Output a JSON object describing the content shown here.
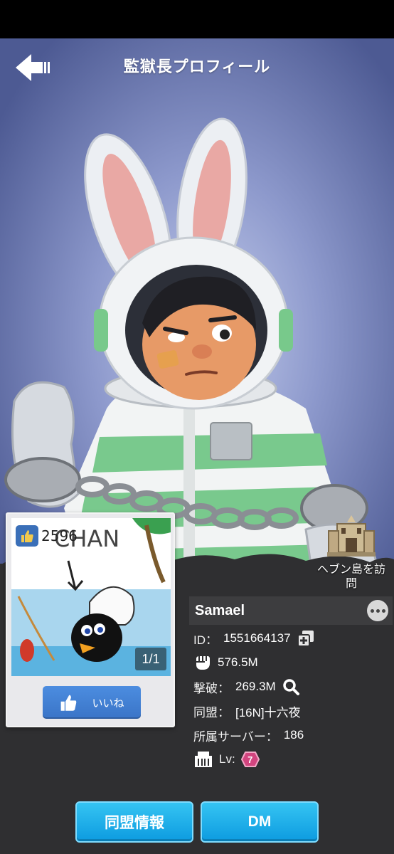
{
  "header": {
    "title": "監獄長プロフィール",
    "back_icon": "arrow-left-icon"
  },
  "photo_card": {
    "like_count": "2596",
    "pager": "1/1",
    "like_button_label": "いいね",
    "photo_caption": "CHAN"
  },
  "visit_island": {
    "label": "ヘブン島を訪問"
  },
  "profile": {
    "name": "Samael",
    "id_label": "ID：",
    "id_value": "1551664137",
    "power_value": "576.5M",
    "kills_label": "撃破：",
    "kills_value": "269.3M",
    "alliance_label": "同盟：",
    "alliance_value": "[16N]十六夜",
    "server_label": "所属サーバー：",
    "server_value": "186",
    "level_label": "Lv:",
    "level_value": "7"
  },
  "buttons": {
    "alliance_info": "同盟情報",
    "dm": "DM"
  },
  "colors": {
    "accent_blue": "#0d9be0",
    "panel": "#2f2f31",
    "like_blue": "#3a74c7"
  }
}
